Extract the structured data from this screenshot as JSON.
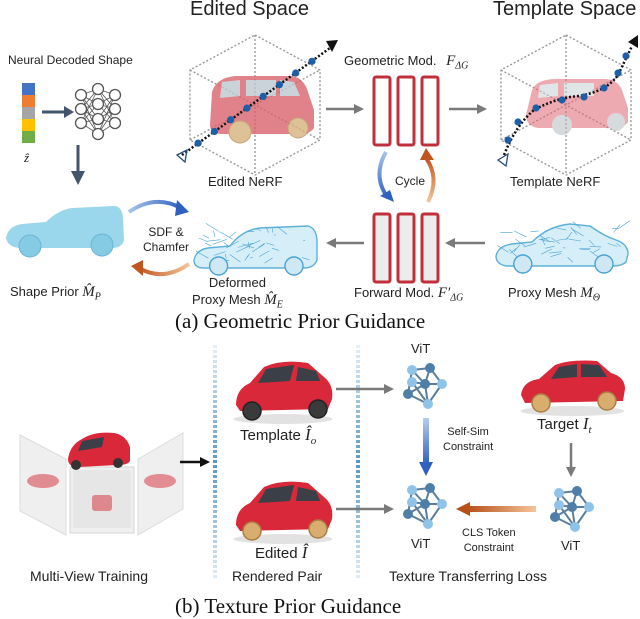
{
  "panel_a": {
    "caption": "(a) Geometric Prior Guidance",
    "edited_space_title": "Edited Space",
    "template_space_title": "Template Space",
    "neural_decoded_shape_label": "Neural Decoded Shape",
    "latent_symbol": "ẑ",
    "latent_colors": [
      "#4472c4",
      "#ed7d31",
      "#a5a5a5",
      "#ffc000",
      "#70ad47"
    ],
    "geometric_mod_label": "Geometric Mod.",
    "geometric_mod_symbol": "F",
    "geometric_mod_subscript": "ΔG",
    "edited_nerf_label": "Edited NeRF",
    "template_nerf_label": "Template NeRF",
    "cycle_label": "Cycle",
    "sdf_chamfer_line1": "SDF &",
    "sdf_chamfer_line2": "Chamfer",
    "shape_prior_label": "Shape Prior",
    "shape_prior_symbol": "M̂",
    "shape_prior_subscript": "P",
    "deformed_label_line1": "Deformed",
    "deformed_label_line2": "Proxy Mesh",
    "deformed_symbol": "M̂",
    "deformed_subscript": "E",
    "forward_mod_label": "Forward Mod.",
    "forward_mod_symbol": "F′",
    "forward_mod_subscript": "ΔG",
    "proxy_mesh_label": "Proxy Mesh",
    "proxy_mesh_symbol": "M",
    "proxy_mesh_subscript": "Θ"
  },
  "panel_b": {
    "caption": "(b) Texture Prior Guidance",
    "multiview_label": "Multi-View Training",
    "template_label": "Template",
    "template_symbol": "Î",
    "template_subscript": "o",
    "edited_label": "Edited",
    "edited_symbol": "Î",
    "rendered_pair_label": "Rendered Pair",
    "vit_label": "ViT",
    "self_sim_line1": "Self-Sim",
    "self_sim_line2": "Constraint",
    "cls_line1": "CLS Token",
    "cls_line2": "Constraint",
    "target_label": "Target",
    "target_symbol": "I",
    "target_subscript": "t",
    "texture_loss_label": "Texture Transferring Loss"
  },
  "colors": {
    "module_red": "#c0303a",
    "blue_arrow": "#3a6fc4",
    "orange_arrow": "#c0561e",
    "ray_dot": "#1f5fa8",
    "mesh_blue": "#8cd0ea",
    "car_red": "#d9283a",
    "vit_dark": "#4f7fa8",
    "vit_light": "#8fc4e8",
    "gray_arrow": "#7a7a7a",
    "dark_arrow": "#44546a"
  }
}
